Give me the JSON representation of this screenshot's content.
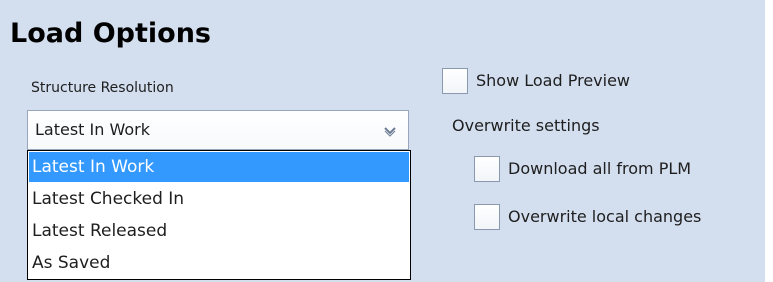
{
  "panel": {
    "title": "Load Options"
  },
  "structure_resolution": {
    "label": "Structure Resolution",
    "selected_value": "Latest In Work",
    "arrow_icon": "chevron-down-icon",
    "options": [
      {
        "label": "Latest In Work",
        "highlighted": true
      },
      {
        "label": "Latest Checked In",
        "highlighted": false
      },
      {
        "label": "Latest Released",
        "highlighted": false
      },
      {
        "label": "As Saved",
        "highlighted": false
      }
    ]
  },
  "show_load_preview": {
    "label": "Show Load Preview",
    "checked": false
  },
  "overwrite_settings": {
    "label": "Overwrite settings",
    "download_all": {
      "label": "Download all from PLM",
      "checked": false
    },
    "overwrite_local": {
      "label": "Overwrite local changes",
      "checked": false
    }
  },
  "colors": {
    "panel_background": "#d3deef",
    "highlight": "#3399ff"
  }
}
